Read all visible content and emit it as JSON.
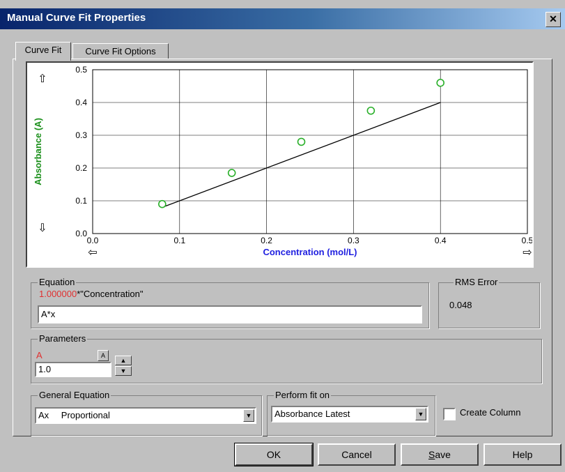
{
  "window": {
    "title": "Manual Curve Fit Properties",
    "close_glyph": "✕"
  },
  "tabs": [
    {
      "label": "Curve Fit"
    },
    {
      "label": "Curve Fit Options"
    }
  ],
  "chart_data": {
    "type": "scatter",
    "xlabel": "Concentration (mol/L)",
    "ylabel": "Absorbance (A)",
    "xlim": [
      0.0,
      0.5
    ],
    "ylim": [
      0.0,
      0.5
    ],
    "x_ticks": [
      "0.0",
      "0.1",
      "0.2",
      "0.3",
      "0.4",
      "0.5"
    ],
    "y_ticks": [
      "0.0",
      "0.1",
      "0.2",
      "0.3",
      "0.4",
      "0.5"
    ],
    "grid": true,
    "series": [
      {
        "type": "scatter",
        "x": [
          0.08,
          0.16,
          0.24,
          0.32,
          0.4
        ],
        "y": [
          0.09,
          0.185,
          0.28,
          0.375,
          0.46
        ]
      },
      {
        "type": "line",
        "x": [
          0.08,
          0.4
        ],
        "y": [
          0.08,
          0.4
        ]
      }
    ],
    "colors": {
      "points": "#2ab02a",
      "line": "#000000",
      "xlabel": "#2020e0",
      "ylabel": "#1a8f1a"
    }
  },
  "equation": {
    "label": "Equation",
    "coef": "1.000000",
    "rest": "*\"Concentration\"",
    "value": "A*x"
  },
  "rms": {
    "label": "RMS Error",
    "value": "0.048"
  },
  "parameters": {
    "label": "Parameters",
    "param_name": "A",
    "param_value": "1.0",
    "lock_glyph": "A"
  },
  "general_equation": {
    "label": "General Equation",
    "code": "Ax",
    "name": "Proportional"
  },
  "perform_fit": {
    "label": "Perform fit on",
    "value": "Absorbance Latest"
  },
  "create_column": {
    "label": "Create Column",
    "checked": false
  },
  "buttons": {
    "ok": "OK",
    "cancel": "Cancel",
    "save": "Save",
    "help": "Help"
  }
}
